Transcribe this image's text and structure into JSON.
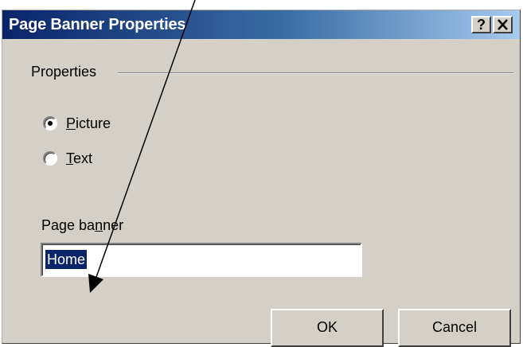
{
  "dialog": {
    "title": "Page Banner Properties",
    "help_button": "?",
    "close_button": "✕"
  },
  "properties_group": {
    "label": "Properties",
    "options": [
      {
        "prefix": "",
        "accel": "P",
        "suffix": "icture",
        "selected": true
      },
      {
        "prefix": "",
        "accel": "T",
        "suffix": "ext",
        "selected": false
      }
    ]
  },
  "banner_field": {
    "label_prefix": "Page ba",
    "label_accel": "n",
    "label_suffix": "ner",
    "value": "Home"
  },
  "buttons": {
    "ok_label": "OK",
    "cancel_label": "Cancel"
  },
  "annotation": {
    "arrow_color": "#000000"
  }
}
